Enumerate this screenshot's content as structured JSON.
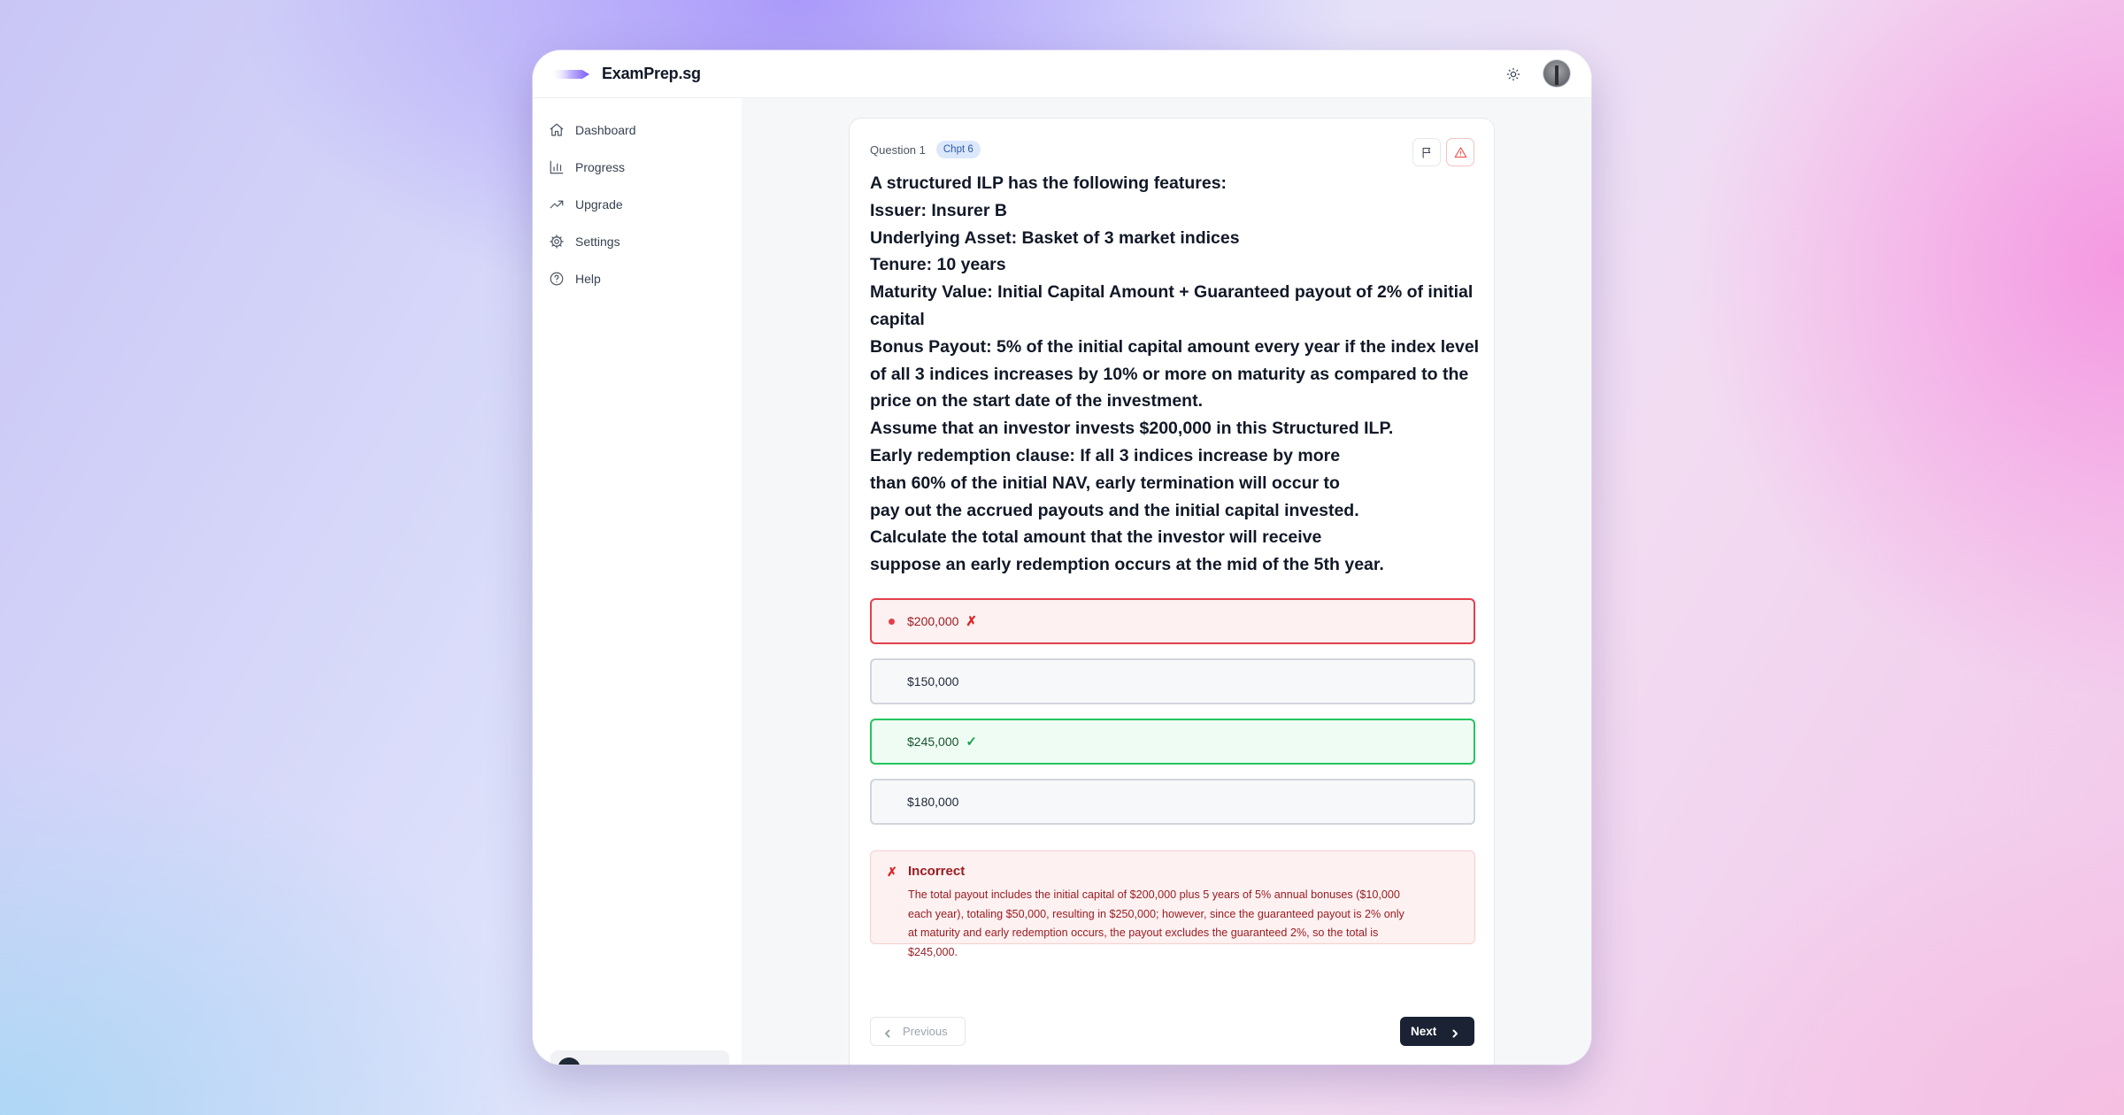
{
  "app": {
    "name": "ExamPrep.sg"
  },
  "sidebar": {
    "items": [
      {
        "label": "Dashboard",
        "icon": "home-icon"
      },
      {
        "label": "Progress",
        "icon": "bar-chart-icon"
      },
      {
        "label": "Upgrade",
        "icon": "trending-up-icon"
      },
      {
        "label": "Settings",
        "icon": "gear-icon"
      },
      {
        "label": "Help",
        "icon": "help-circle-icon"
      }
    ]
  },
  "topbar": {
    "theme_icon": "sun-icon",
    "avatar_icon": "user-avatar"
  },
  "question": {
    "label": "Question 1",
    "chapter": "Chpt 6",
    "lines": [
      "A structured ILP has the following features:",
      "Issuer: Insurer B",
      "Underlying Asset: Basket of 3 market indices",
      "Tenure: 10 years",
      "Maturity Value: Initial Capital Amount + Guaranteed payout of 2% of initial",
      "capital",
      "Bonus Payout: 5% of the initial capital amount every year if the index level",
      "of all 3 indices increases by 10% or more on maturity as compared to the",
      "price on the start date of the investment.",
      "Assume that an investor invests $200,000 in this Structured ILP.",
      "Early redemption clause: If all 3 indices increase by more",
      "than 60% of the initial NAV, early termination will occur to",
      "pay out the accrued payouts and the initial capital invested.",
      "Calculate the total amount that the investor will receive",
      "suppose an early redemption occurs at the mid of the 5th year."
    ]
  },
  "options": [
    {
      "text": "$200,000",
      "state": "selected-wrong",
      "mark": "✗"
    },
    {
      "text": "$150,000",
      "state": "neutral",
      "mark": ""
    },
    {
      "text": "$245,000",
      "state": "correct",
      "mark": "✓"
    },
    {
      "text": "$180,000",
      "state": "neutral",
      "mark": ""
    }
  ],
  "feedback": {
    "icon": "✗",
    "title": "Incorrect",
    "lines": [
      "The total payout includes the initial capital of $200,000 plus 5 years of 5% annual bonuses ($10,000",
      "each year), totaling $50,000, resulting in $250,000; however, since the guaranteed payout is 2% only",
      "at maturity and early redemption occurs, the payout excludes the guaranteed 2%, so the total is",
      "$245,000."
    ]
  },
  "nav_buttons": {
    "previous": "Previous",
    "next": "Next"
  },
  "colors": {
    "wrong": "#e53e4a",
    "correct": "#22c55e",
    "primary_button": "#1a2233",
    "badge_bg": "#dbe7fb"
  }
}
